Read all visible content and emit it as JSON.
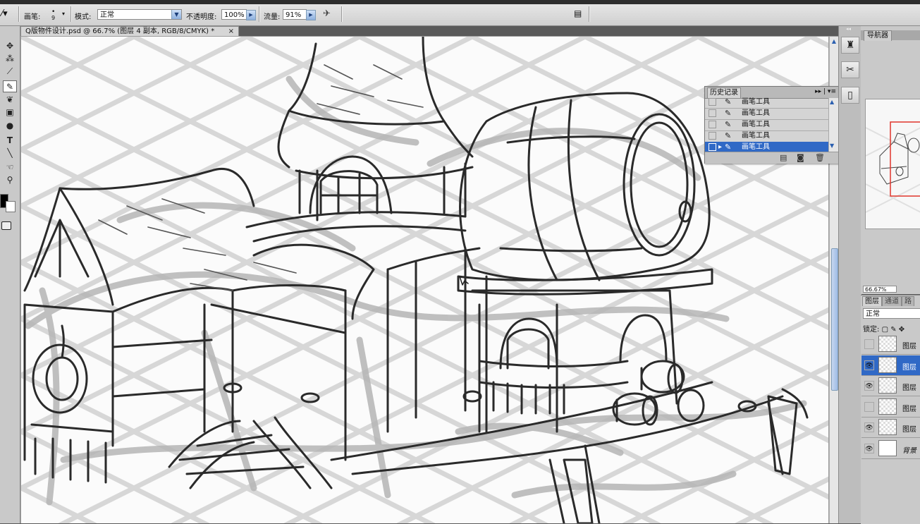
{
  "options_bar": {
    "brush_label": "画笔:",
    "brush_size": "9",
    "mode_label": "模式:",
    "mode_value": "正常",
    "opacity_label": "不透明度:",
    "opacity_value": "100%",
    "flow_label": "流量:",
    "flow_value": "91%"
  },
  "document": {
    "tab_title": "Q版物件设计.psd @ 66.7% (图层 4 副本, RGB/8/CMYK) *",
    "close_glyph": "×"
  },
  "history_panel": {
    "title": "历史记录",
    "menu_glyph": "▸▸ | ▾≡",
    "items": [
      {
        "label": "画笔工具"
      },
      {
        "label": "画笔工具"
      },
      {
        "label": "画笔工具"
      },
      {
        "label": "画笔工具"
      },
      {
        "label": "画笔工具"
      }
    ]
  },
  "navigator_panel": {
    "title": "导航器",
    "zoom": "66.67%"
  },
  "layers_panel": {
    "tabs": [
      "图层",
      "通道",
      "路"
    ],
    "blend_mode": "正常",
    "lock_label": "锁定:",
    "layers": [
      {
        "name": "图层",
        "visible": false,
        "selected": false
      },
      {
        "name": "图层",
        "visible": true,
        "selected": true
      },
      {
        "name": "图层",
        "visible": true,
        "selected": false
      },
      {
        "name": "图层",
        "visible": false,
        "selected": false
      },
      {
        "name": "图层",
        "visible": true,
        "selected": false
      },
      {
        "name": "背景",
        "visible": true,
        "selected": false
      }
    ]
  },
  "colors": {
    "selection": "#3069c6",
    "panel_bg": "#c9c9c9",
    "canvas": "#fbfbfb"
  }
}
